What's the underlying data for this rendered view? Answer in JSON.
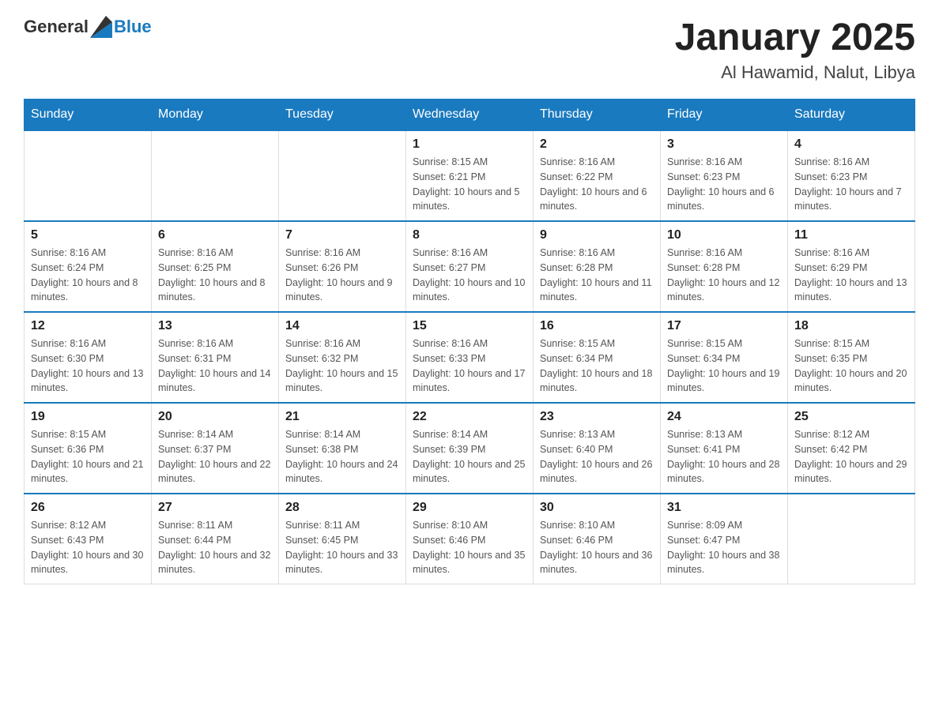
{
  "header": {
    "logo_general": "General",
    "logo_blue": "Blue",
    "title": "January 2025",
    "subtitle": "Al Hawamid, Nalut, Libya"
  },
  "days_of_week": [
    "Sunday",
    "Monday",
    "Tuesday",
    "Wednesday",
    "Thursday",
    "Friday",
    "Saturday"
  ],
  "weeks": [
    [
      {
        "day": "",
        "info": ""
      },
      {
        "day": "",
        "info": ""
      },
      {
        "day": "",
        "info": ""
      },
      {
        "day": "1",
        "info": "Sunrise: 8:15 AM\nSunset: 6:21 PM\nDaylight: 10 hours and 5 minutes."
      },
      {
        "day": "2",
        "info": "Sunrise: 8:16 AM\nSunset: 6:22 PM\nDaylight: 10 hours and 6 minutes."
      },
      {
        "day": "3",
        "info": "Sunrise: 8:16 AM\nSunset: 6:23 PM\nDaylight: 10 hours and 6 minutes."
      },
      {
        "day": "4",
        "info": "Sunrise: 8:16 AM\nSunset: 6:23 PM\nDaylight: 10 hours and 7 minutes."
      }
    ],
    [
      {
        "day": "5",
        "info": "Sunrise: 8:16 AM\nSunset: 6:24 PM\nDaylight: 10 hours and 8 minutes."
      },
      {
        "day": "6",
        "info": "Sunrise: 8:16 AM\nSunset: 6:25 PM\nDaylight: 10 hours and 8 minutes."
      },
      {
        "day": "7",
        "info": "Sunrise: 8:16 AM\nSunset: 6:26 PM\nDaylight: 10 hours and 9 minutes."
      },
      {
        "day": "8",
        "info": "Sunrise: 8:16 AM\nSunset: 6:27 PM\nDaylight: 10 hours and 10 minutes."
      },
      {
        "day": "9",
        "info": "Sunrise: 8:16 AM\nSunset: 6:28 PM\nDaylight: 10 hours and 11 minutes."
      },
      {
        "day": "10",
        "info": "Sunrise: 8:16 AM\nSunset: 6:28 PM\nDaylight: 10 hours and 12 minutes."
      },
      {
        "day": "11",
        "info": "Sunrise: 8:16 AM\nSunset: 6:29 PM\nDaylight: 10 hours and 13 minutes."
      }
    ],
    [
      {
        "day": "12",
        "info": "Sunrise: 8:16 AM\nSunset: 6:30 PM\nDaylight: 10 hours and 13 minutes."
      },
      {
        "day": "13",
        "info": "Sunrise: 8:16 AM\nSunset: 6:31 PM\nDaylight: 10 hours and 14 minutes."
      },
      {
        "day": "14",
        "info": "Sunrise: 8:16 AM\nSunset: 6:32 PM\nDaylight: 10 hours and 15 minutes."
      },
      {
        "day": "15",
        "info": "Sunrise: 8:16 AM\nSunset: 6:33 PM\nDaylight: 10 hours and 17 minutes."
      },
      {
        "day": "16",
        "info": "Sunrise: 8:15 AM\nSunset: 6:34 PM\nDaylight: 10 hours and 18 minutes."
      },
      {
        "day": "17",
        "info": "Sunrise: 8:15 AM\nSunset: 6:34 PM\nDaylight: 10 hours and 19 minutes."
      },
      {
        "day": "18",
        "info": "Sunrise: 8:15 AM\nSunset: 6:35 PM\nDaylight: 10 hours and 20 minutes."
      }
    ],
    [
      {
        "day": "19",
        "info": "Sunrise: 8:15 AM\nSunset: 6:36 PM\nDaylight: 10 hours and 21 minutes."
      },
      {
        "day": "20",
        "info": "Sunrise: 8:14 AM\nSunset: 6:37 PM\nDaylight: 10 hours and 22 minutes."
      },
      {
        "day": "21",
        "info": "Sunrise: 8:14 AM\nSunset: 6:38 PM\nDaylight: 10 hours and 24 minutes."
      },
      {
        "day": "22",
        "info": "Sunrise: 8:14 AM\nSunset: 6:39 PM\nDaylight: 10 hours and 25 minutes."
      },
      {
        "day": "23",
        "info": "Sunrise: 8:13 AM\nSunset: 6:40 PM\nDaylight: 10 hours and 26 minutes."
      },
      {
        "day": "24",
        "info": "Sunrise: 8:13 AM\nSunset: 6:41 PM\nDaylight: 10 hours and 28 minutes."
      },
      {
        "day": "25",
        "info": "Sunrise: 8:12 AM\nSunset: 6:42 PM\nDaylight: 10 hours and 29 minutes."
      }
    ],
    [
      {
        "day": "26",
        "info": "Sunrise: 8:12 AM\nSunset: 6:43 PM\nDaylight: 10 hours and 30 minutes."
      },
      {
        "day": "27",
        "info": "Sunrise: 8:11 AM\nSunset: 6:44 PM\nDaylight: 10 hours and 32 minutes."
      },
      {
        "day": "28",
        "info": "Sunrise: 8:11 AM\nSunset: 6:45 PM\nDaylight: 10 hours and 33 minutes."
      },
      {
        "day": "29",
        "info": "Sunrise: 8:10 AM\nSunset: 6:46 PM\nDaylight: 10 hours and 35 minutes."
      },
      {
        "day": "30",
        "info": "Sunrise: 8:10 AM\nSunset: 6:46 PM\nDaylight: 10 hours and 36 minutes."
      },
      {
        "day": "31",
        "info": "Sunrise: 8:09 AM\nSunset: 6:47 PM\nDaylight: 10 hours and 38 minutes."
      },
      {
        "day": "",
        "info": ""
      }
    ]
  ]
}
